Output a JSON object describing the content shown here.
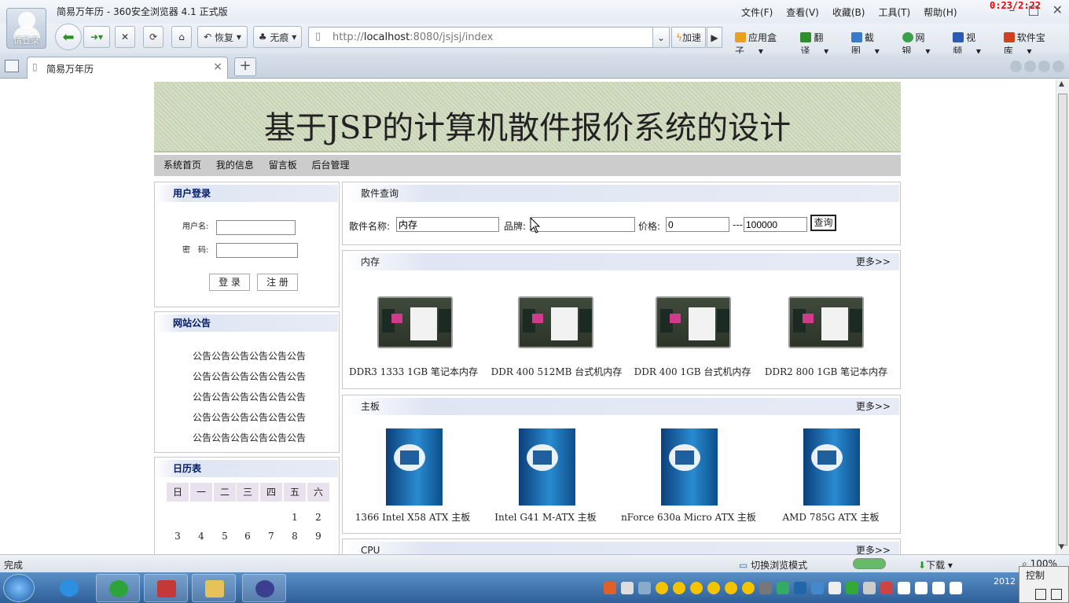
{
  "browser": {
    "avatar_label": "请登录",
    "window_title": "简易万年历 - 360安全浏览器 4.1 正式版",
    "menu": [
      "文件(F)",
      "查看(V)",
      "收藏(B)",
      "工具(T)",
      "帮助(H)"
    ],
    "timer": "0:23/2:22",
    "toolbar": {
      "restore": "恢复",
      "incognito": "无痕",
      "accelerate": "加速"
    },
    "address": {
      "scheme": "http://",
      "host": "localhost",
      "rest": ":8080/jsjsj/index"
    },
    "right_tools": [
      "应用盒子",
      "翻译",
      "截图",
      "网银",
      "视频",
      "软件宝库"
    ],
    "tab_title": "简易万年历"
  },
  "page": {
    "banner_title": "基于JSP的计算机散件报价系统的设计",
    "nav": [
      "系统首页",
      "我的信息",
      "留言板",
      "后台管理"
    ],
    "login": {
      "title": "用户登录",
      "username_label": "用户名:",
      "password_label": "密　码:",
      "login_button": "登 录",
      "register_button": "注 册"
    },
    "notice": {
      "title": "网站公告",
      "items": [
        "公告公告公告公告公告公告",
        "公告公告公告公告公告公告",
        "公告公告公告公告公告公告",
        "公告公告公告公告公告公告",
        "公告公告公告公告公告公告"
      ]
    },
    "calendar": {
      "title": "日历表",
      "weekdays": [
        "日",
        "一",
        "二",
        "三",
        "四",
        "五",
        "六"
      ],
      "row1": [
        "1",
        "2"
      ],
      "row2": [
        "3",
        "4",
        "5",
        "6",
        "7",
        "8",
        "9"
      ]
    },
    "search": {
      "title": "散件查询",
      "name_label": "散件名称:",
      "name_value": "内存",
      "brand_label": "品牌:",
      "brand_value": "",
      "price_label": "价格:",
      "price_min": "0",
      "price_sep": "---",
      "price_max": "100000",
      "query_button": "查询"
    },
    "sections": [
      {
        "title": "内存",
        "more": "更多>>",
        "products": [
          "DDR3 1333 1GB 笔记本内存",
          "DDR 400 512MB 台式机内存",
          "DDR 400 1GB 台式机内存",
          "DDR2 800 1GB 笔记本内存"
        ]
      },
      {
        "title": "主板",
        "more": "更多>>",
        "products": [
          "1366 Intel X58 ATX 主板",
          "Intel G41 M-ATX 主板",
          "nForce 630a Micro ATX 主板",
          "AMD 785G ATX 主板"
        ]
      },
      {
        "title": "CPU",
        "more": "更多>>"
      }
    ]
  },
  "statusbar": {
    "status": "完成",
    "mode": "切换浏览模式",
    "download": "下载",
    "zoom": "100%"
  },
  "taskbar": {
    "control": "控制",
    "clock": "2012"
  }
}
